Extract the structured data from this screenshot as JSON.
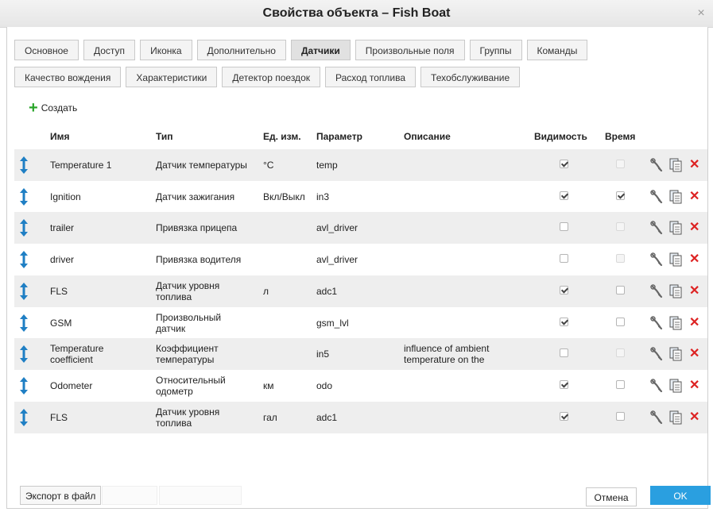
{
  "window": {
    "title": "Свойства объекта – Fish Boat",
    "close_glyph": "×"
  },
  "tabs_row1": [
    "Основное",
    "Доступ",
    "Иконка",
    "Дополнительно",
    "Датчики",
    "Произвольные поля",
    "Группы",
    "Команды"
  ],
  "tabs_row2": [
    "Качество вождения",
    "Характеристики",
    "Детектор поездок",
    "Расход топлива",
    "Техобслуживание"
  ],
  "active_tab": "Датчики",
  "toolbar": {
    "create_label": "Создать"
  },
  "columns": {
    "name": "Имя",
    "type": "Тип",
    "unit": "Ед. изм.",
    "param": "Параметр",
    "desc": "Описание",
    "visible": "Видимость",
    "time": "Время"
  },
  "rows": [
    {
      "name": "Temperature 1",
      "type": "Датчик температуры",
      "unit": "°C",
      "param": "temp",
      "desc": "",
      "visible": true,
      "time": false,
      "time_enabled": false
    },
    {
      "name": "Ignition",
      "type": "Датчик зажигания",
      "unit": "Вкл/Выкл",
      "param": "in3",
      "desc": "",
      "visible": true,
      "time": true,
      "time_enabled": true
    },
    {
      "name": "trailer",
      "type": "Привязка прицепа",
      "unit": "",
      "param": "avl_driver",
      "desc": "",
      "visible": false,
      "time": false,
      "time_enabled": false
    },
    {
      "name": "driver",
      "type": "Привязка водителя",
      "unit": "",
      "param": "avl_driver",
      "desc": "",
      "visible": false,
      "time": false,
      "time_enabled": false
    },
    {
      "name": "FLS",
      "type": "Датчик уровня топлива",
      "unit": "л",
      "param": "adc1",
      "desc": "",
      "visible": true,
      "time": false,
      "time_enabled": true
    },
    {
      "name": "GSM",
      "type": "Произвольный датчик",
      "unit": "",
      "param": "gsm_lvl",
      "desc": "",
      "visible": true,
      "time": false,
      "time_enabled": true
    },
    {
      "name": "Temperature coefficient",
      "type": "Коэффициент температуры",
      "unit": "",
      "param": "in5",
      "desc": "influence of ambient temperature on the",
      "visible": false,
      "time": false,
      "time_enabled": false
    },
    {
      "name": "Odometer",
      "type": "Относительный одометр",
      "unit": "км",
      "param": "odo",
      "desc": "",
      "visible": true,
      "time": false,
      "time_enabled": true
    },
    {
      "name": "FLS",
      "type": "Датчик уровня топлива",
      "unit": "гал",
      "param": "adc1",
      "desc": "",
      "visible": true,
      "time": false,
      "time_enabled": true
    }
  ],
  "footer": {
    "export_label": "Экспорт в файл",
    "cancel_label": "Отмена",
    "ok_label": "OK"
  },
  "colors": {
    "accent": "#2a9fe0",
    "delete": "#dd2222",
    "create": "#2aa52a",
    "row_alt": "#eeeeee"
  }
}
